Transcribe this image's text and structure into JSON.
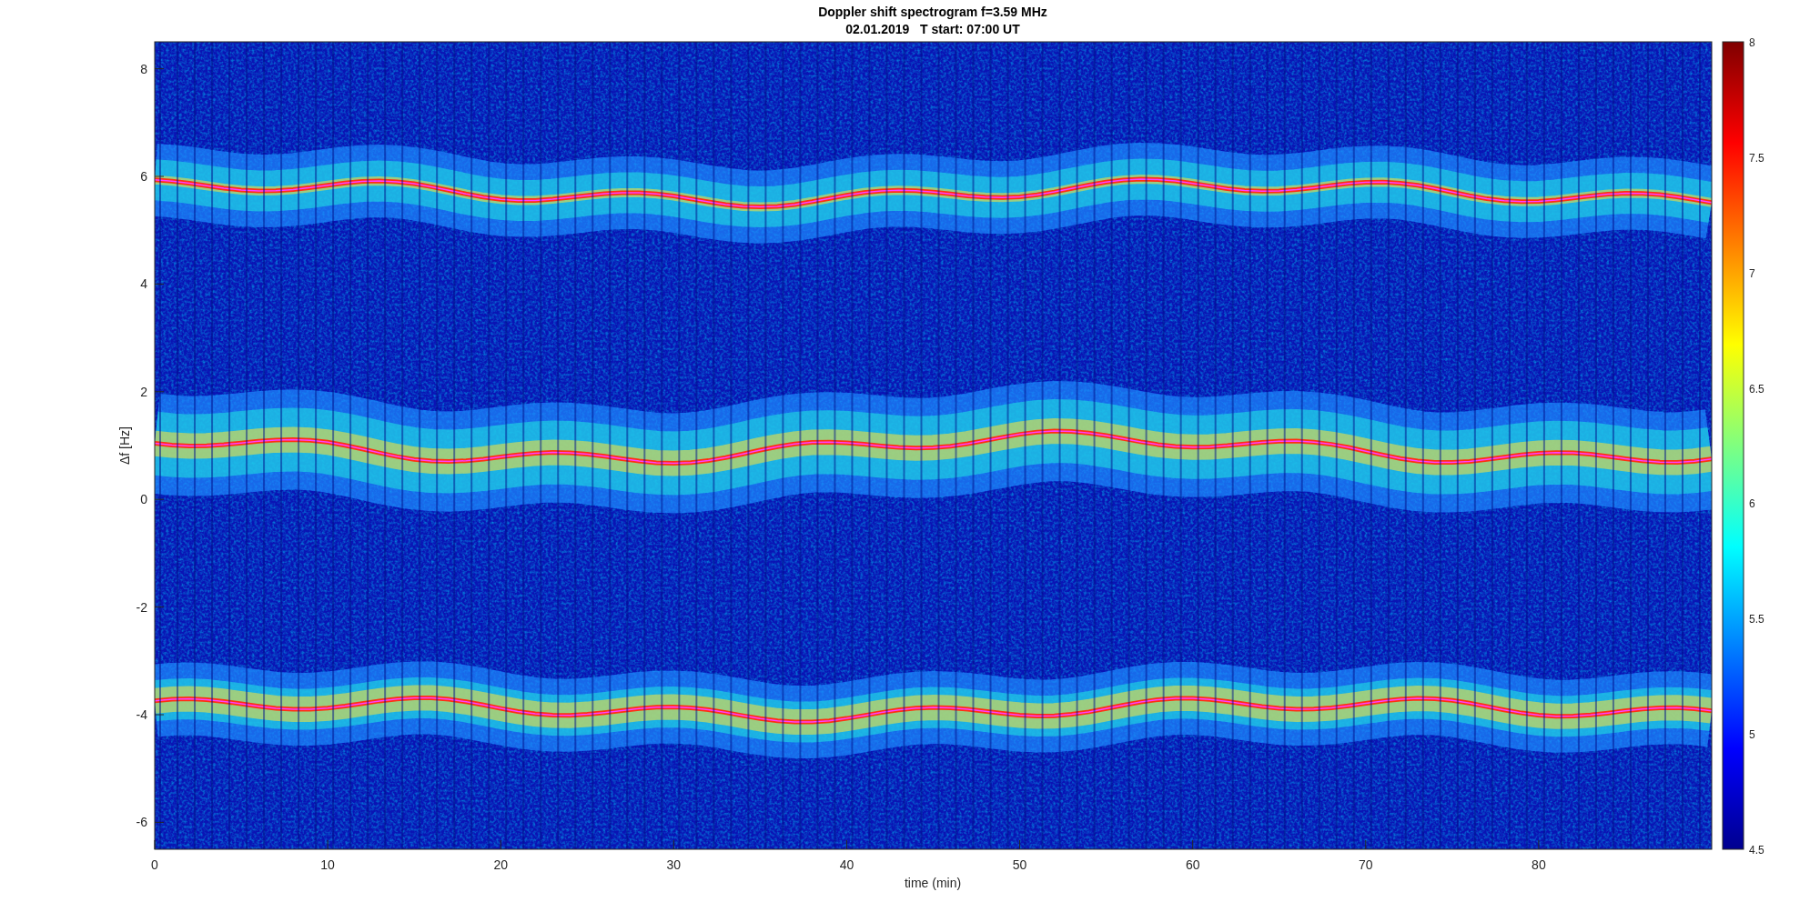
{
  "figure": {
    "title": "Doppler shift spectrogram f=3.59 MHz",
    "subtitle": "02.01.2019   T start: 07:00 UT",
    "xlabel": "time (min)",
    "ylabel": "Δf [Hz]",
    "xticks": [
      "0",
      "10",
      "20",
      "30",
      "40",
      "50",
      "60",
      "70",
      "80"
    ],
    "yticks": [
      "8",
      "6",
      "4",
      "2",
      "0",
      "-2",
      "-4",
      "-6"
    ],
    "colorbar_ticks": [
      "8",
      "7.5",
      "7",
      "6.5",
      "6",
      "5.5",
      "5",
      "4.5"
    ]
  }
}
